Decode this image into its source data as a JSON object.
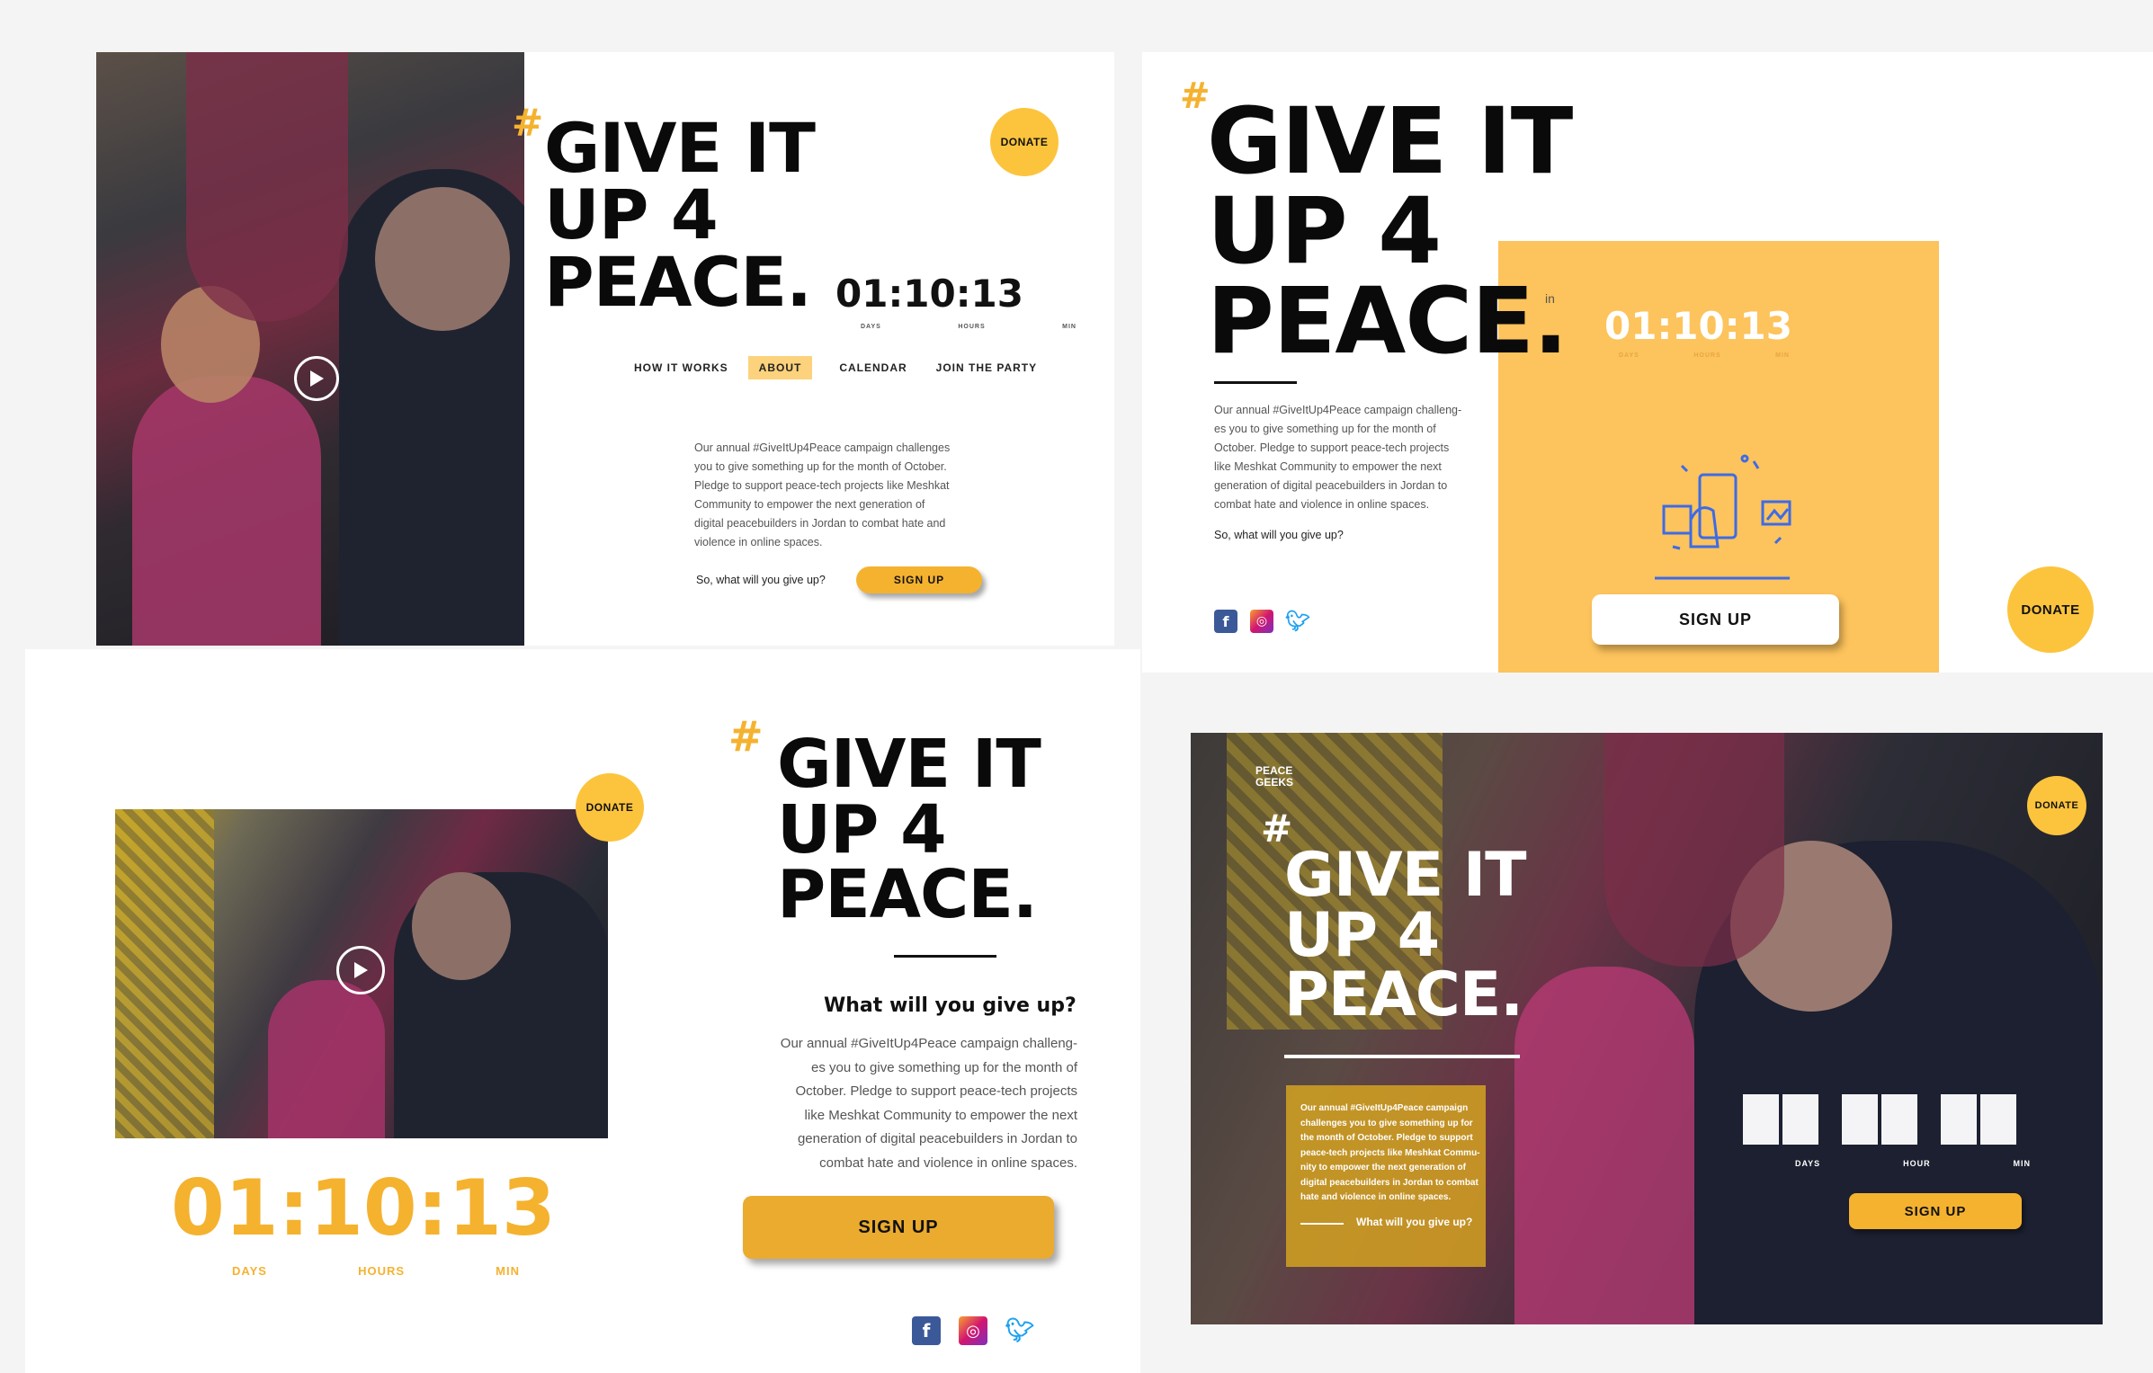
{
  "brand": {
    "hash": "#",
    "headline": [
      "GIVE IT",
      "UP 4",
      "PEACE."
    ]
  },
  "common": {
    "donate": "DONATE",
    "signup": "SIGN UP",
    "timer": "01:10:13",
    "labels": {
      "days": "DAYS",
      "hours": "HOURS",
      "min": "MIN",
      "hour": "HOUR"
    },
    "body": "Our annual #GiveItUp4Peace campaign challenges you to give something up for the month of October. Pledge to support peace-tech projects like Meshkat Community to empower the next generation of digital peacebuilders in Jordan to combat hate and violence in online spaces.",
    "prompt": "So, what will you give up?",
    "prompt_title": "What will you give up?"
  },
  "panel1": {
    "nav": [
      "HOW IT WORKS",
      "ABOUT",
      "CALENDAR",
      "JOIN THE PARTY"
    ],
    "body_lines": [
      "Our annual #GiveItUp4Peace campaign challenges",
      "you to give something up for the month of October.",
      "Pledge to support peace-tech projects like Meshkat",
      "Community to empower the next generation of",
      "digital peacebuilders in Jordan to combat hate and",
      "violence in online spaces."
    ]
  },
  "panel2": {
    "body_lines": [
      "Our annual #GiveItUp4Peace campaign challeng-",
      "es you to give something up for the month of",
      "October. Pledge to support peace-tech projects",
      "like Meshkat Community to empower the next",
      "generation of digital peacebuilders in Jordan to",
      "combat hate and violence in online spaces."
    ],
    "in_label": "in"
  },
  "panel3": {
    "body_lines": [
      "Our annual #GiveItUp4Peace campaign challeng-",
      "es you to give something up for the month of",
      "October. Pledge to support peace-tech projects",
      "like Meshkat Community to empower the next",
      "generation of digital peacebuilders in Jordan to",
      "combat hate and violence in online spaces."
    ]
  },
  "panel4": {
    "logo": [
      "PEACE",
      "GEEKS"
    ],
    "body_lines": [
      "Our annual #GiveItUp4Peace campaign",
      "challenges you to give something up for",
      "the month of October. Pledge to support",
      "peace-tech projects like Meshkat Commu-",
      "nity to empower the next generation of",
      "digital peacebuilders in Jordan to combat",
      "hate and violence in online spaces."
    ]
  },
  "colors": {
    "accent": "#fcc43d",
    "orange": "#f5b22f",
    "panel_yellow": "#fdc35c"
  }
}
